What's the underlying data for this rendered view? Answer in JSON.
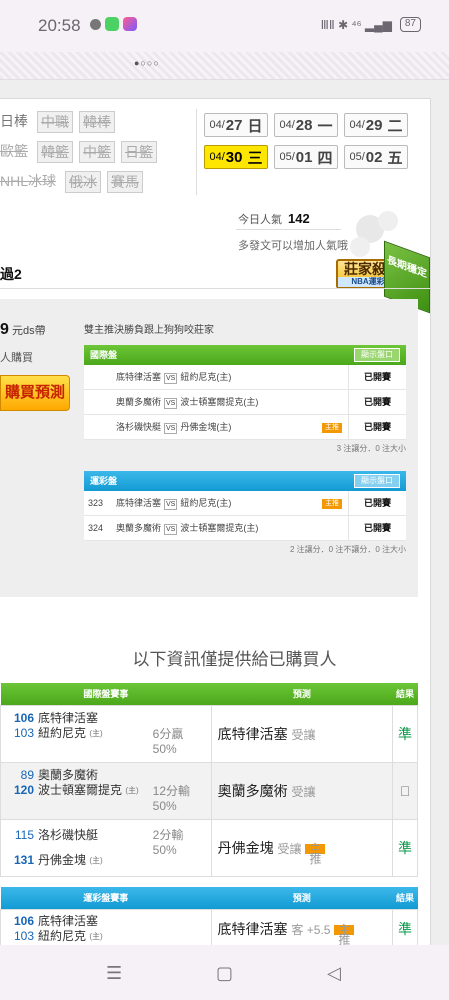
{
  "status": {
    "time": "20:58",
    "right": "ⅢⅡ ✱ ⁴⁶ ▂▄▆",
    "battery": "87"
  },
  "browser": {
    "tab_indicator": "●○○○"
  },
  "leagues": {
    "row1": [
      "日棒",
      "中職",
      "韓棒"
    ],
    "row2": [
      "歐籃",
      "韓籃",
      "中籃",
      "日籃"
    ],
    "row3": [
      "NHL冰球",
      "俄冰",
      "賽馬"
    ]
  },
  "dates": [
    {
      "md": "04/",
      "d": "27",
      "w": "日"
    },
    {
      "md": "04/",
      "d": "28",
      "w": "一"
    },
    {
      "md": "04/",
      "d": "29",
      "w": "二"
    },
    {
      "md": "04/",
      "d": "30",
      "w": "三"
    },
    {
      "md": "05/",
      "d": "01",
      "w": "四"
    },
    {
      "md": "05/",
      "d": "02",
      "w": "五"
    }
  ],
  "popularity": {
    "label": "今日人氣",
    "value": "142",
    "hint": "多發文可以增加人氣哦"
  },
  "expert": {
    "title": "莊家殺手",
    "sub": "NBA運彩盤",
    "corner": "長期穩定"
  },
  "section_title": "過2",
  "preview": {
    "price_num": "9",
    "price_unit": "元ds帶",
    "buyers": "人購買",
    "buy_button": "購買預測",
    "description": "雙主推決勝負跟上狗狗咬莊家",
    "intl": {
      "header": "國際盤",
      "show": "顯示盤口",
      "rows": [
        {
          "num": "",
          "away": "底特律活塞",
          "home": "紐約尼克(主)",
          "status": "已開賽",
          "badge": ""
        },
        {
          "num": "",
          "away": "奧蘭多魔術",
          "home": "波士頓塞爾提克(主)",
          "status": "已開賽",
          "badge": ""
        },
        {
          "num": "",
          "away": "洛杉磯快艇",
          "home": "丹佛金塊(主)",
          "status": "已開賽",
          "badge": "主推"
        }
      ],
      "summary": "3 注讓分．0 注大小"
    },
    "sport": {
      "header": "運彩盤",
      "show": "顯示盤口",
      "rows": [
        {
          "num": "323",
          "away": "底特律活塞",
          "home": "紐約尼克(主)",
          "status": "已開賽",
          "badge": "主推"
        },
        {
          "num": "324",
          "away": "奧蘭多魔術",
          "home": "波士頓塞爾提克(主)",
          "status": "已開賽",
          "badge": ""
        }
      ],
      "summary": "2 注讓分．0 注不讓分．0 注大小"
    },
    "vs": "VS"
  },
  "notice": "以下資訊僅提供給已購買人",
  "intl_table": {
    "headers": [
      "國際盤賽事",
      "預測",
      "結果"
    ],
    "rows": [
      {
        "n1": "106",
        "t1": "底特律活塞",
        "n2": "103",
        "t2": "紐約尼克",
        "home": "(主)",
        "odds1": "6分贏",
        "odds2": "50%",
        "pick": "底特律活塞",
        "pick_type": "受讓",
        "badge": "",
        "result": "準"
      },
      {
        "n1": "89",
        "t1": "奧蘭多魔術",
        "n2": "120",
        "t2": "波士頓塞爾提克",
        "home": "(主)",
        "odds1": "12分輸",
        "odds2": "50%",
        "pick": "奧蘭多魔術",
        "pick_type": "受讓",
        "badge": "",
        "result": "𠆿"
      },
      {
        "n1": "115",
        "t1": "洛杉磯快艇",
        "n2": "131",
        "t2": "丹佛金塊",
        "home": "(主)",
        "odds1": "2分輸",
        "odds2": "50%",
        "pick": "丹佛金塊",
        "pick_type": "受讓",
        "badge": "主推",
        "result": "準"
      }
    ]
  },
  "sport_table": {
    "headers": [
      "運彩盤賽事",
      "預測",
      "結果"
    ],
    "rows": [
      {
        "n1": "106",
        "t1": "底特律活塞",
        "n2": "103",
        "t2": "紐約尼克",
        "home": "(主)",
        "pick": "底特律活塞",
        "pick_type": "客 +5.5",
        "badge": "主推",
        "result": "準"
      }
    ]
  },
  "nav": {
    "menu": "☰",
    "home": "▢",
    "back": "◁"
  }
}
